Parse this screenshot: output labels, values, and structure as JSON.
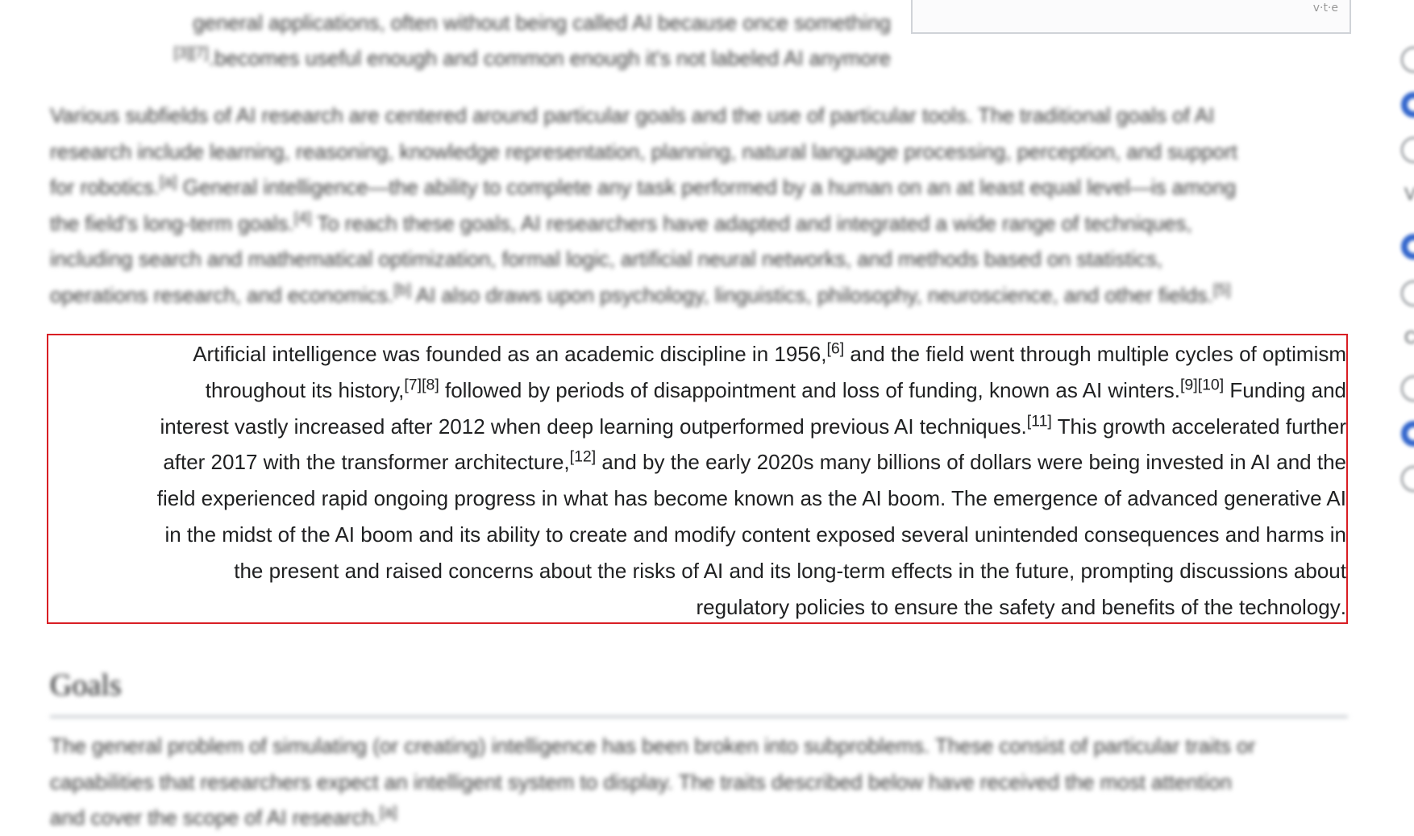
{
  "intro_tail": {
    "line1": "general applications, often without being called AI because once something",
    "line2_ref": "[3][7]",
    "line2_text": ".becomes useful enough and common enough it's not labeled AI anymore"
  },
  "infobox_footer": "v·t·e",
  "subfields": {
    "l1": "Various subfields of AI research are centered around particular goals and the use of particular tools. The traditional goals of AI",
    "l2": "research include learning, reasoning, knowledge representation, planning, natural language processing, perception, and support",
    "l3a": "for robotics.",
    "l3_ref": "[a]",
    "l3b": " General intelligence—the ability to complete any task performed by a human on an at least equal level—is among",
    "l4a": "the field's long-term goals.",
    "l4_ref": "[4]",
    "l4b": " To reach these goals, AI researchers have adapted and integrated a wide range of techniques,",
    "l5": "including search and mathematical optimization, formal logic, artificial neural networks, and methods based on statistics,",
    "l6a": "operations research, and economics.",
    "l6_ref": "[b]",
    "l6b": " AI also draws upon psychology, linguistics, philosophy, neuroscience, and other fields.",
    "l6_ref2": "[5]"
  },
  "history": {
    "l1a": "Artificial intelligence was founded as an academic discipline in 1956,",
    "l1_ref": "[6]",
    "l1b": " and the field went through multiple cycles of optimism",
    "l2a": "throughout its history,",
    "l2_ref": "[7][8]",
    "l2b": " followed by periods of disappointment and loss of funding, known as AI winters.",
    "l2_ref2": "[9][10]",
    "l2c": " Funding and",
    "l3a": "interest vastly increased after 2012 when deep learning outperformed previous AI techniques.",
    "l3_ref": "[11]",
    "l3b": " This growth accelerated further",
    "l4a": "after 2017 with the transformer architecture,",
    "l4_ref": "[12]",
    "l4b": " and by the early 2020s many billions of dollars were being invested in AI and the",
    "l5": "field experienced rapid ongoing progress in what has become known as the AI boom. The emergence of advanced generative AI",
    "l6": "in the midst of the AI boom and its ability to create and modify content exposed several unintended consequences and harms in",
    "l7": "the present and raised concerns about the risks of AI and its long-term effects in the future, prompting discussions about",
    "l8": ".regulatory policies to ensure the safety and benefits of the technology"
  },
  "goals": {
    "heading": "Goals",
    "l1": "The general problem of simulating (or creating) intelligence has been broken into subproblems. These consist of particular traits or",
    "l2": "capabilities that researchers expect an intelligent system to display. The traits described below have received the most attention",
    "l3a": "and cover the scope of AI research.",
    "l3_ref": "[a]"
  },
  "side": {
    "letter_v": "V",
    "letter_c": "C"
  },
  "colors": {
    "highlight_border": "#d91e24",
    "radio_selected": "#3366cc",
    "text": "#202122"
  }
}
